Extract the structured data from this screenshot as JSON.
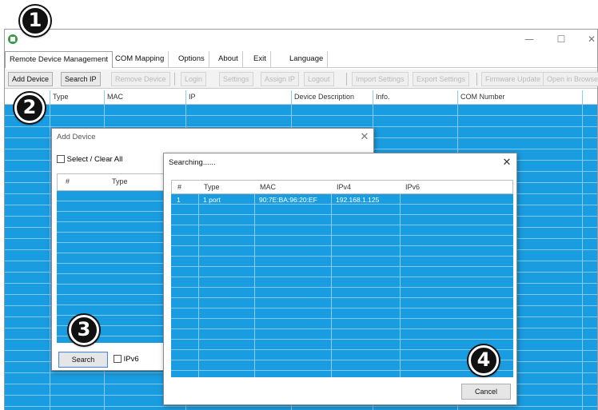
{
  "window": {
    "controls": {
      "minimize": "—",
      "maximize": "☐",
      "close": "✕"
    }
  },
  "menu": {
    "tabs": [
      "Remote Device Management",
      "COM Mapping",
      "Options",
      "About",
      "Exit",
      "Language"
    ],
    "active": "Remote Device Management"
  },
  "toolbar": {
    "buttons": [
      {
        "label": "Add Device",
        "enabled": true
      },
      {
        "label": "Search IP",
        "enabled": true
      },
      {
        "label": "Remove Device",
        "enabled": false
      },
      {
        "label": "Login",
        "enabled": false
      },
      {
        "label": "Settings",
        "enabled": false
      },
      {
        "label": "Assign IP",
        "enabled": false
      },
      {
        "label": "Logout",
        "enabled": false
      },
      {
        "label": "Import Settings",
        "enabled": false
      },
      {
        "label": "Export Settings",
        "enabled": false
      },
      {
        "label": "Firmware Update",
        "enabled": false
      },
      {
        "label": "Open in Browser",
        "enabled": false
      }
    ]
  },
  "main_grid": {
    "columns": [
      "Type",
      "MAC",
      "IP",
      "Device Description",
      "Info.",
      "COM Number"
    ]
  },
  "add_device_dialog": {
    "title": "Add Device",
    "close": "✕",
    "select_all_label": "Select / Clear All",
    "columns": [
      "#",
      "Type"
    ],
    "search_button": "Search",
    "ipv6_label": "IPv6"
  },
  "searching_dialog": {
    "title": "Searching......",
    "close": "✕",
    "columns": [
      "#",
      "Type",
      "MAC",
      "IPv4",
      "IPv6"
    ],
    "rows": [
      {
        "index": "1",
        "type": "1 port",
        "mac": "90:7E:BA:96:20:EF",
        "ipv4": "192.168.1.125",
        "ipv6": ""
      }
    ],
    "cancel_button": "Cancel"
  },
  "callouts": [
    "1",
    "2",
    "3",
    "4"
  ],
  "colors": {
    "grid_blue": "#1a9ce0",
    "grid_line": "#7fc8ef",
    "app_icon": "#3a9a4a"
  }
}
